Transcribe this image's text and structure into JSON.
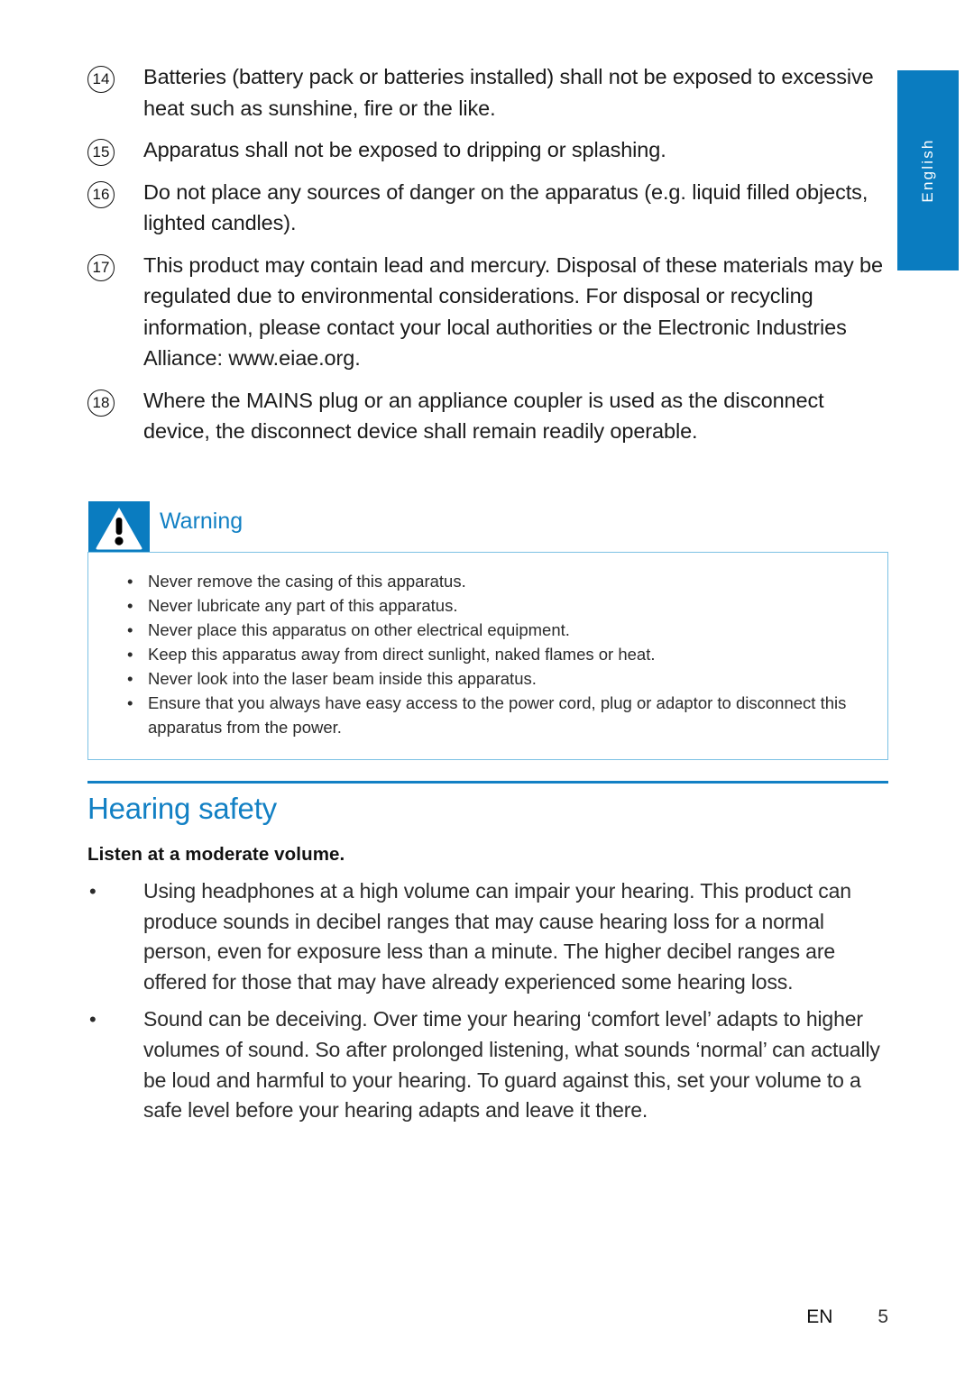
{
  "colors": {
    "accent_blue": "#0a7cc0",
    "title_blue": "#1280c4",
    "warning_box_border": "#7cc1e4",
    "body_text": "#2b2b2b"
  },
  "side_tab": {
    "label": "English"
  },
  "numbered_list": [
    {
      "number": "14",
      "text": "Batteries (battery pack or batteries installed) shall not be exposed to excessive heat such as sunshine, fire or the like."
    },
    {
      "number": "15",
      "text": "Apparatus shall not be exposed to dripping or splashing."
    },
    {
      "number": "16",
      "text": "Do not place any sources of danger on the apparatus (e.g. liquid filled objects, lighted candles)."
    },
    {
      "number": "17",
      "text": "This product may contain lead and mercury. Disposal of these materials may be regulated due to environmental considerations. For disposal or recycling information, please contact your local authorities or the Electronic Industries Alliance: www.eiae.org."
    },
    {
      "number": "18",
      "text": "Where the MAINS plug or an appliance coupler is used as the disconnect device, the disconnect device shall remain readily operable."
    }
  ],
  "warning": {
    "icon": "warning-triangle-icon",
    "title": "Warning",
    "bullet_glyph": "•",
    "items": [
      "Never remove the casing of this apparatus.",
      "Never lubricate any part of this apparatus.",
      "Never place this apparatus on other electrical equipment.",
      "Keep this apparatus away from direct sunlight, naked flames or heat.",
      "Never look into the laser beam inside this apparatus.",
      "Ensure that you always have easy access to the power cord, plug or adaptor to disconnect this apparatus from the power."
    ]
  },
  "hearing_safety": {
    "section_title": "Hearing safety",
    "subheading": "Listen at a moderate volume.",
    "bullet_glyph": "•",
    "bullets": [
      "Using headphones at a high volume can impair your hearing. This product can produce sounds in decibel ranges that may cause hearing loss for a normal person, even for exposure less than a minute. The higher decibel ranges are offered for those that may have already experienced some hearing loss.",
      "Sound can be deceiving. Over time your hearing ‘comfort level’ adapts to higher volumes of sound. So after prolonged listening, what sounds ‘normal’ can actually be loud and harmful to your hearing. To guard against this, set your volume to a safe level before your hearing adapts and leave it there."
    ]
  },
  "footer": {
    "language_code": "EN",
    "page_number": "5"
  }
}
